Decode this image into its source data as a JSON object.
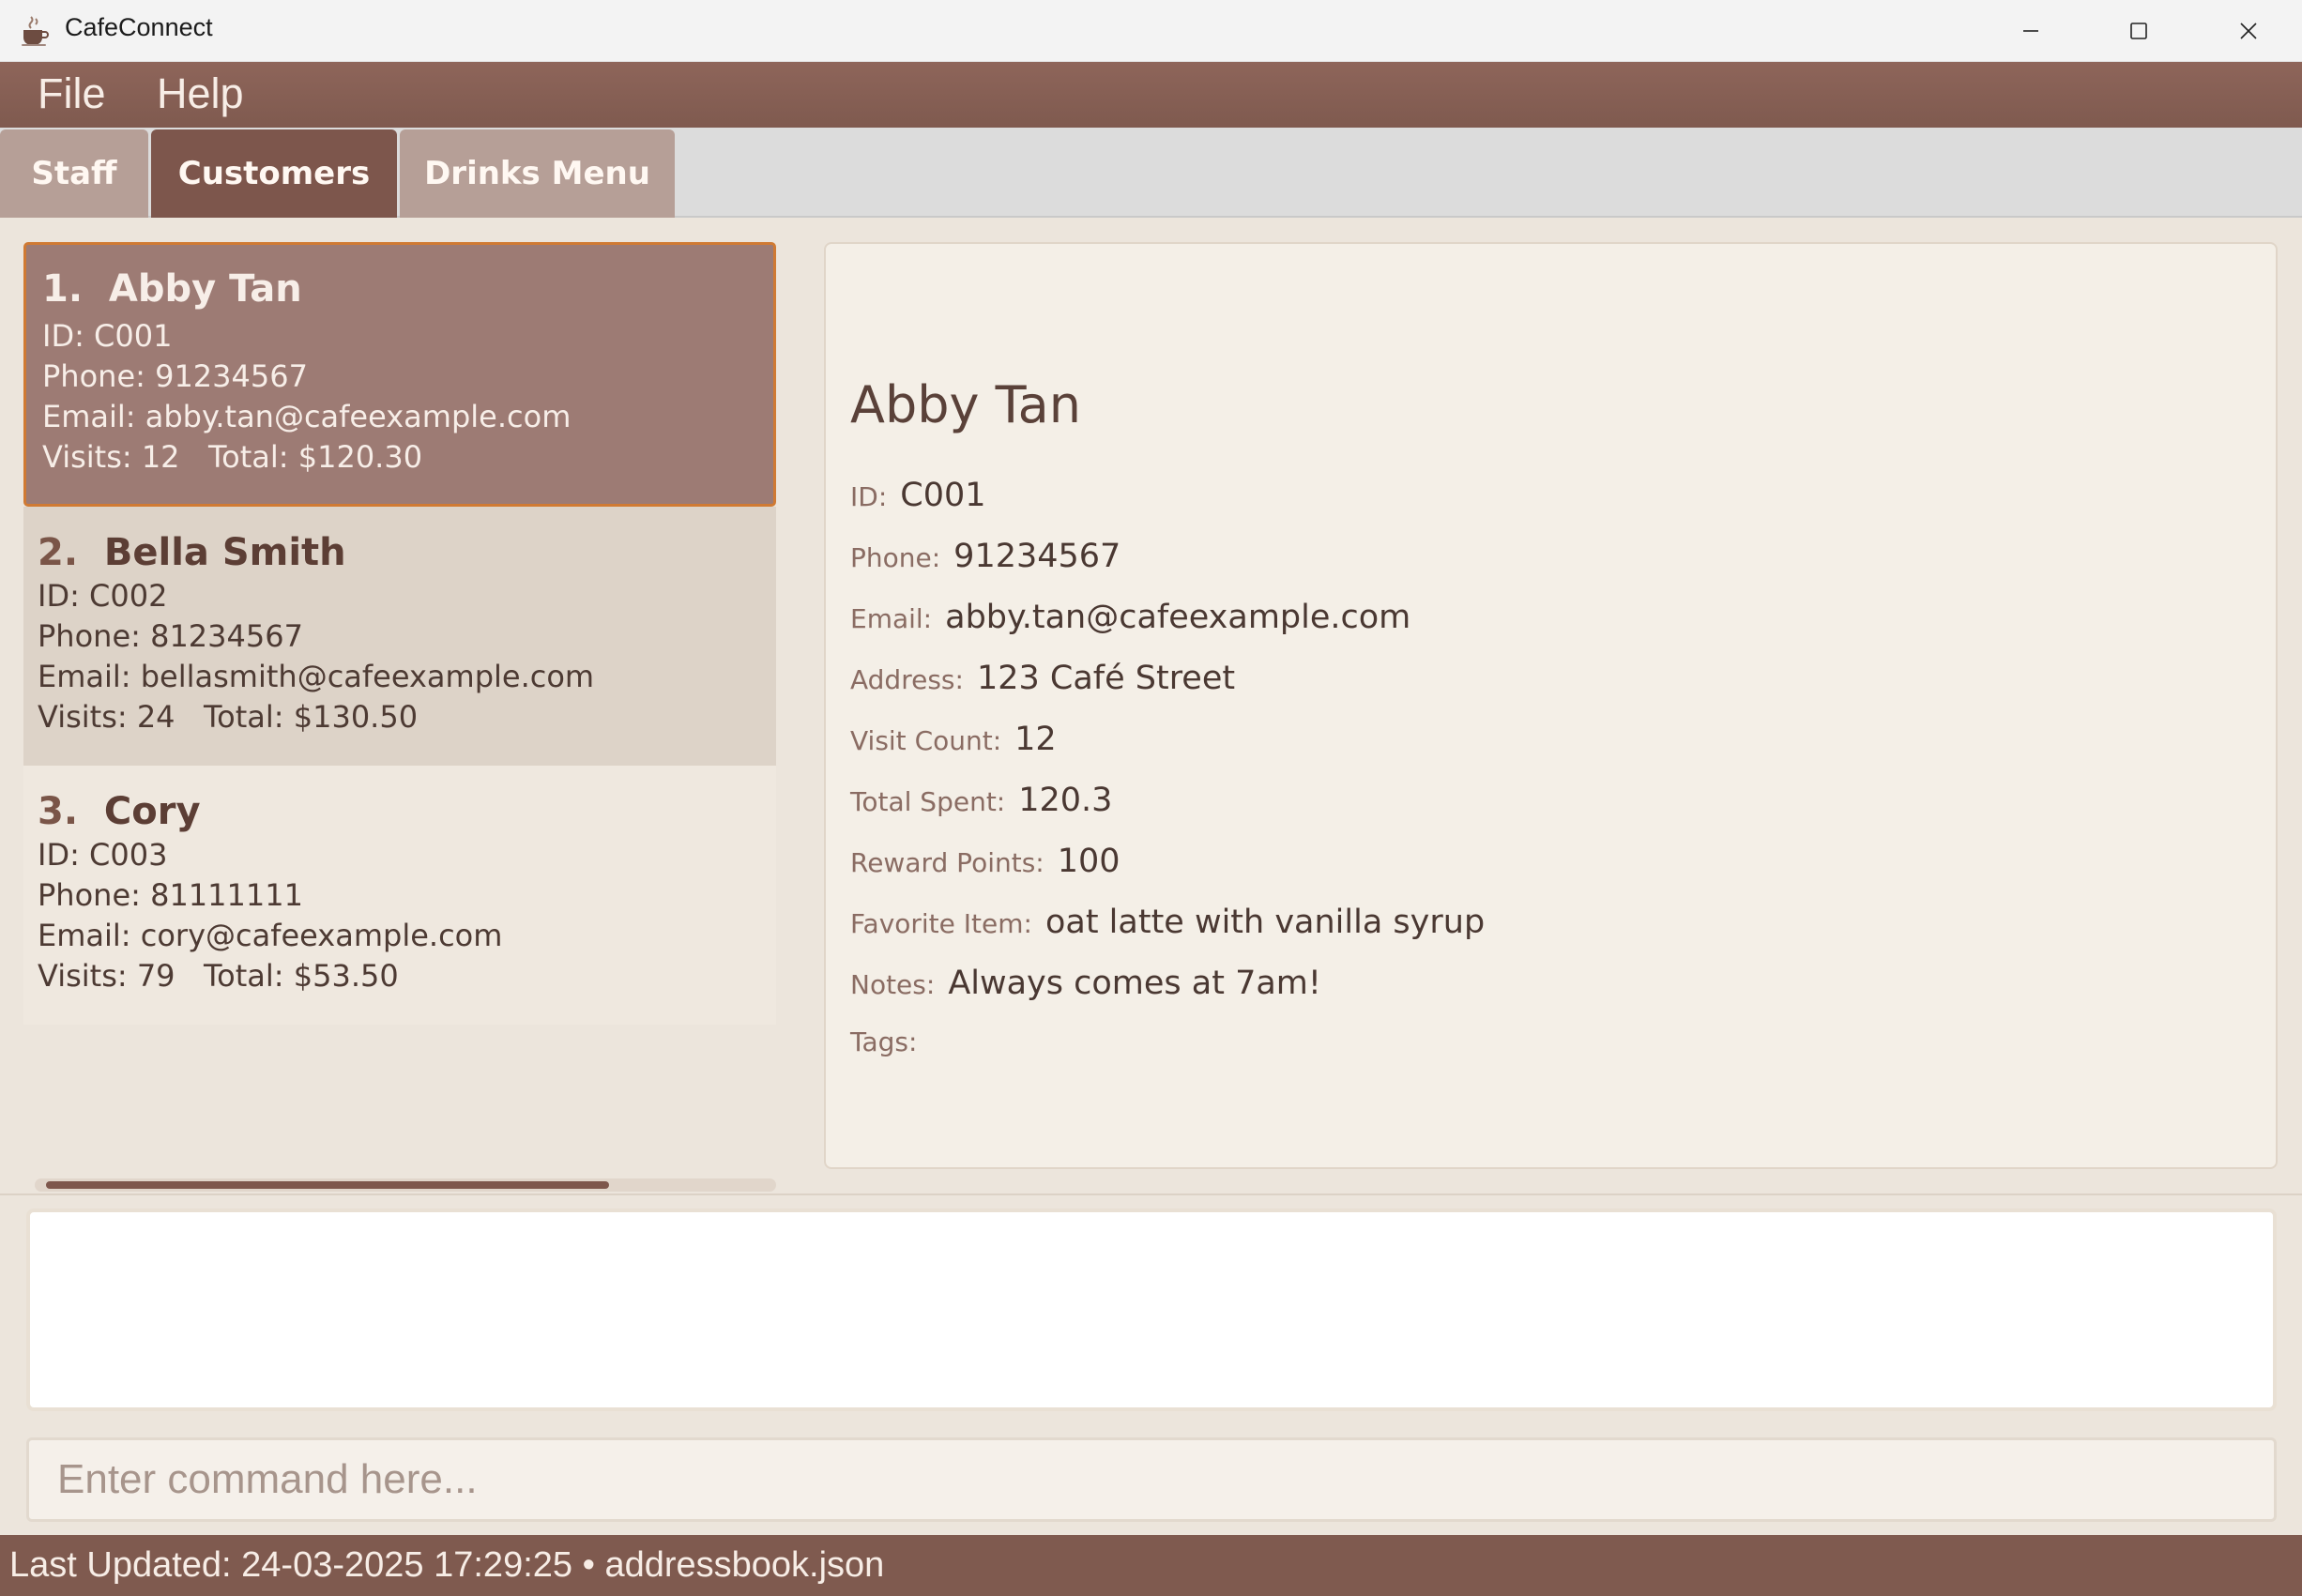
{
  "window": {
    "title": "CafeConnect",
    "icon": "coffee-cup-icon"
  },
  "menu": {
    "file": "File",
    "help": "Help"
  },
  "tabs": [
    {
      "label": "Staff",
      "active": false
    },
    {
      "label": "Customers",
      "active": true
    },
    {
      "label": "Drinks Menu",
      "active": false
    }
  ],
  "customers": [
    {
      "index": "1.",
      "name": "Abby Tan",
      "id_line": "ID: C001",
      "phone_line": "Phone: 91234567",
      "email_line": "Email: abby.tan@cafeexample.com",
      "stats_line": "Visits: 12   Total: $120.30",
      "selected": true
    },
    {
      "index": "2.",
      "name": "Bella Smith",
      "id_line": "ID: C002",
      "phone_line": "Phone: 81234567",
      "email_line": "Email: bellasmith@cafeexample.com",
      "stats_line": "Visits: 24   Total: $130.50",
      "selected": false
    },
    {
      "index": "3.",
      "name": "Cory",
      "id_line": "ID: C003",
      "phone_line": "Phone: 81111111",
      "email_line": "Email: cory@cafeexample.com",
      "stats_line": "Visits: 79   Total: $53.50",
      "selected": false
    }
  ],
  "detail": {
    "name": "Abby Tan",
    "fields": [
      {
        "label": "ID:",
        "value": "C001"
      },
      {
        "label": "Phone:",
        "value": "91234567"
      },
      {
        "label": "Email:",
        "value": "abby.tan@cafeexample.com"
      },
      {
        "label": "Address:",
        "value": "123 Café Street"
      },
      {
        "label": "Visit Count:",
        "value": "12"
      },
      {
        "label": "Total Spent:",
        "value": "120.3"
      },
      {
        "label": "Reward Points:",
        "value": "100"
      },
      {
        "label": "Favorite Item:",
        "value": "oat latte with vanilla syrup"
      },
      {
        "label": "Notes:",
        "value": "Always comes at 7am!"
      },
      {
        "label": "Tags:",
        "value": ""
      }
    ]
  },
  "result": {
    "text": ""
  },
  "command": {
    "placeholder": "Enter command here...",
    "value": ""
  },
  "status": {
    "text": "Last Updated: 24-03-2025 17:29:25 • addressbook.json"
  },
  "colors": {
    "brand_brown": "#7f5a4f",
    "selected_card": "#9d7b74",
    "selected_border": "#d07a33",
    "panel_bg": "#f4efe7"
  }
}
